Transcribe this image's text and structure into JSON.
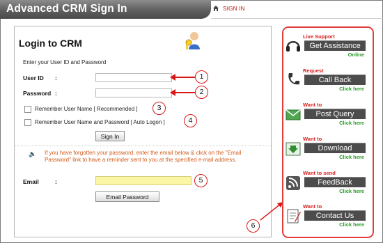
{
  "window": {
    "title": "Advanced CRM Sign In"
  },
  "nav": {
    "sign_in_link": "SIGN IN"
  },
  "login": {
    "heading": "Login to CRM",
    "instruction": "Enter your User ID and Password",
    "user_id_label": "User ID",
    "password_label": "Password",
    "colon": ":",
    "user_id_value": "",
    "password_value": "",
    "remember_user": "Remember User Name [ Recommended ]",
    "remember_user_pass": "Remember User Name and Password [ Auto Logon ]",
    "sign_in_button": "Sign In"
  },
  "forgot": {
    "text": "If you have forgotten your password, enter the email below & click on the \"Email Password\" link to have a reminder sent to you at the specified e-mail address.",
    "email_label": "Email",
    "email_value": "",
    "email_password_button": "Email Password"
  },
  "callouts": [
    "1",
    "2",
    "3",
    "4",
    "5",
    "6"
  ],
  "support_panel": [
    {
      "caption": "Live Support",
      "label": "Get Assistance",
      "sub": "Online",
      "icon": "headset-icon"
    },
    {
      "caption": "Request",
      "label": "Call Back",
      "sub": "Click here",
      "icon": "phone-icon"
    },
    {
      "caption": "Want to",
      "label": "Post Query",
      "sub": "Click here",
      "icon": "envelope-icon"
    },
    {
      "caption": "Want to",
      "label": "Download",
      "sub": "Click here",
      "icon": "download-icon"
    },
    {
      "caption": "Want to send",
      "label": "FeedBack",
      "sub": "Click here",
      "icon": "rss-icon"
    },
    {
      "caption": "Want to",
      "label": "Contact Us",
      "sub": "Click here",
      "icon": "notepad-icon"
    }
  ],
  "colors": {
    "accent_red": "#d81818",
    "header_gray": "#5f5f5f",
    "link_green": "#2a9a2a",
    "notice_orange": "#d45a1a",
    "email_bg": "#fbf6a6"
  }
}
